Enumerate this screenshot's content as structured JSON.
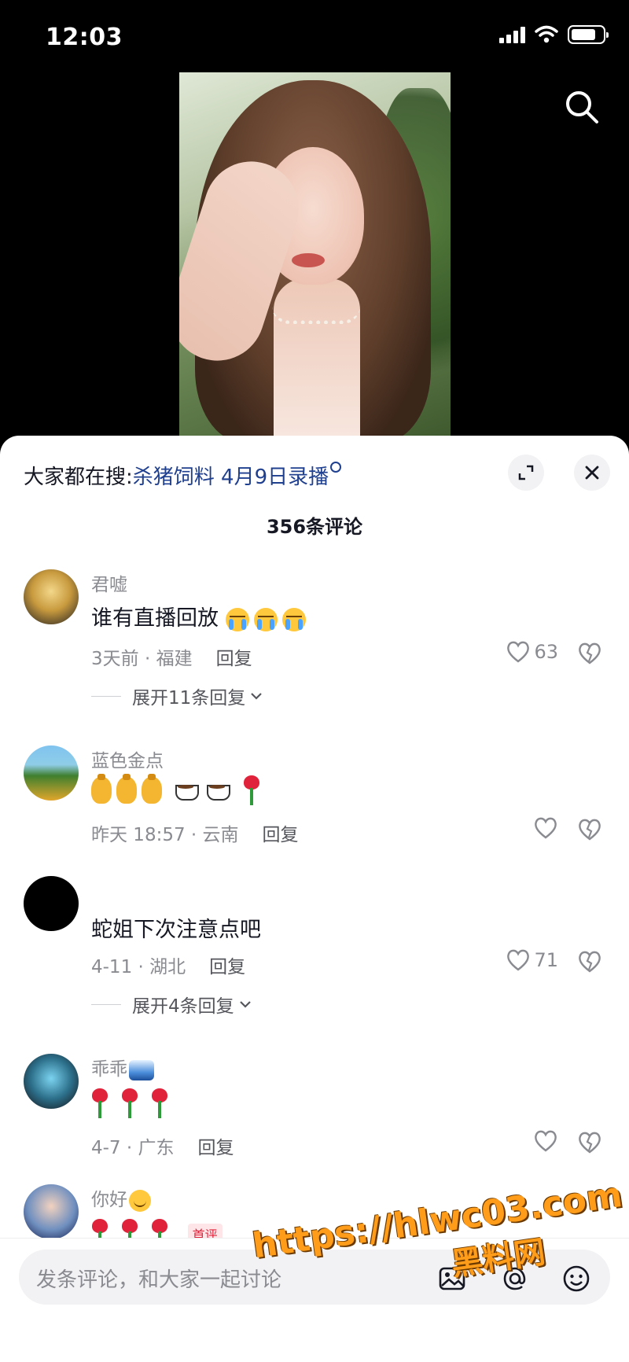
{
  "status_bar": {
    "time": "12:03"
  },
  "panel": {
    "hot_search_prefix": "大家都在搜:",
    "hot_search_term": "杀猪饲料 4月9日录播",
    "comment_count_title": "356条评论"
  },
  "comments": [
    {
      "user": "君嘘",
      "text": "谁有直播回放",
      "time_location": "3天前 · 福建",
      "reply_label": "回复",
      "likes": "63",
      "expand_label": "展开11条回复"
    },
    {
      "user": "蓝色金点",
      "text": "",
      "time_location": "昨天 18:57 · 云南",
      "reply_label": "回复",
      "likes": ""
    },
    {
      "user": "",
      "text": "蛇姐下次注意点吧",
      "time_location": "4-11 · 湖北",
      "reply_label": "回复",
      "likes": "71",
      "expand_label": "展开4条回复"
    },
    {
      "user": "乖乖",
      "text": "",
      "time_location": "4-7 · 广东",
      "reply_label": "回复",
      "likes": ""
    },
    {
      "user": "你好",
      "text": "",
      "tag": "首评"
    }
  ],
  "input": {
    "placeholder": "发条评论，和大家一起讨论"
  },
  "watermark": {
    "url": "https://hlwc03.com",
    "name": "黑料网"
  },
  "icons": [
    "search-icon",
    "expand-icon",
    "close-icon",
    "heart-icon",
    "dislike-heart-icon",
    "chevron-down-icon",
    "image-icon",
    "at-icon",
    "emoji-icon"
  ]
}
